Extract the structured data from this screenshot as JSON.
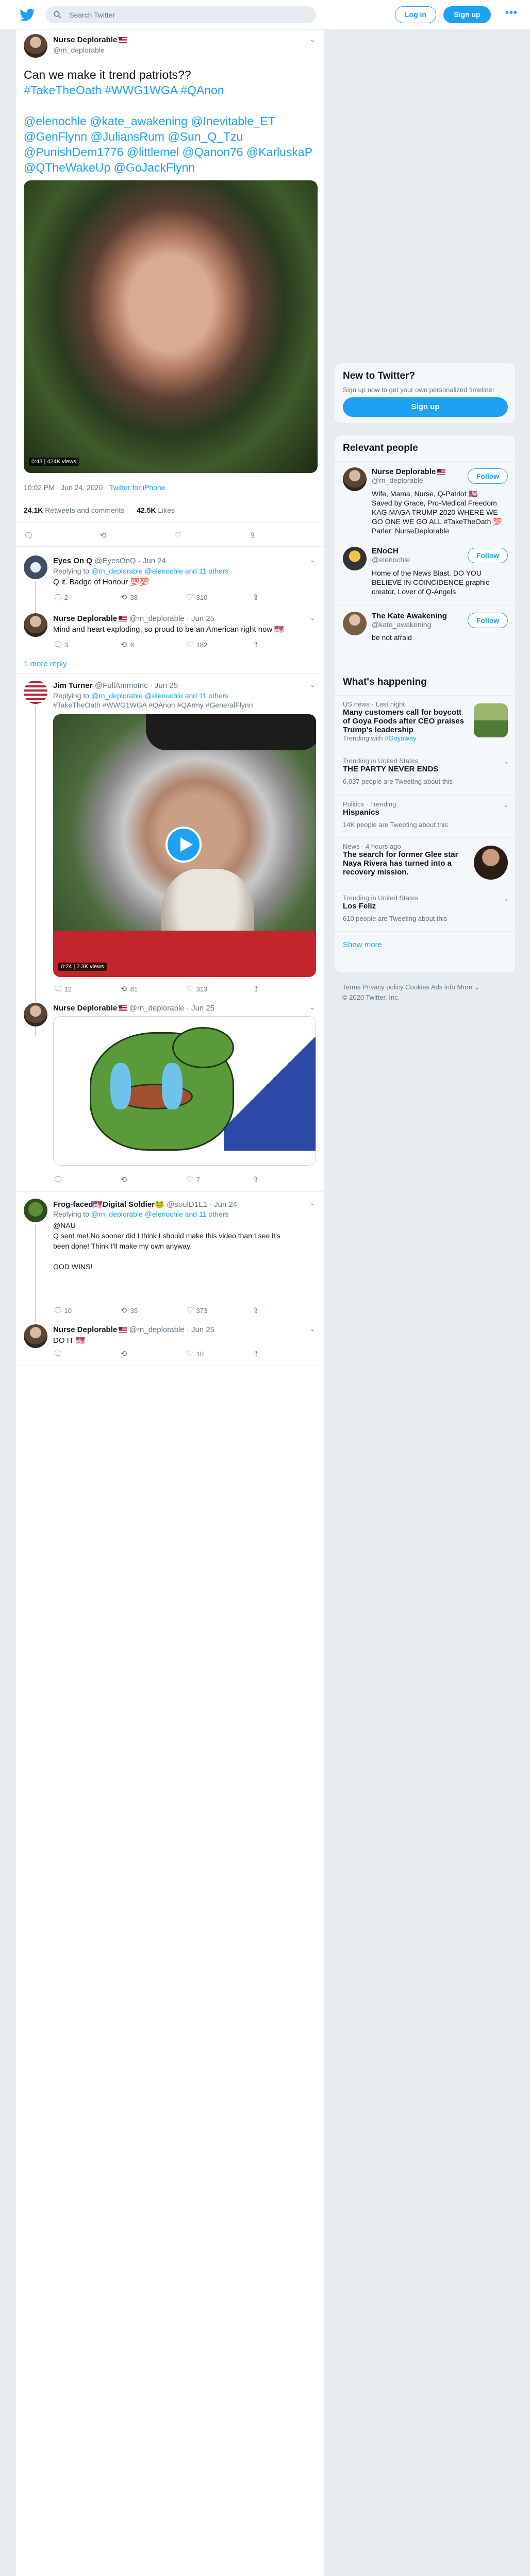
{
  "topbar": {
    "search_placeholder": "Search Twitter",
    "login_label": "Log in",
    "signup_label": "Sign up",
    "more_label": "•••"
  },
  "colors": {
    "accent": "#1da1f2",
    "text": "#14171a",
    "muted": "#657786",
    "background": "#e6ecf0"
  },
  "main_tweet": {
    "name": "Nurse Deplorable",
    "handle": "@rn_deplorable",
    "text_line1": "Can we make it trend patriots??",
    "hashtags_line": "#TakeTheOath #WWG1WGA #QAnon",
    "mentions_lines": [
      "@elenochle @kate_awakening @Inevitable_ET",
      "@GenFlynn @JuliansRum @Sun_Q_Tzu",
      "@PunishDem1776 @littlemel @Qanon76 @KarluskaP",
      "@QTheWakeUp @GoJackFlynn"
    ],
    "video_time": "0:43",
    "video_views": "424K views",
    "timestamp": "10:02 PM · Jun 24, 2020 ·",
    "source": "Twitter for iPhone",
    "retweets_count": "24.1K",
    "retweets_label": "Retweets and comments",
    "likes_count": "42.5K",
    "likes_label": "Likes"
  },
  "replies": [
    {
      "name": "Eyes On Q",
      "handle": "@EyesOnQ · Jun 24",
      "replying": "Replying to",
      "replying_to": "@rn_deplorable @elenochle and 11 others",
      "text": "Q it. Badge of Honour 💯💯",
      "reply_count": "2",
      "retweet_count": "38",
      "like_count": "310"
    },
    {
      "name": "Nurse Deplorable",
      "handle": "@rn_deplorable · Jun 25",
      "text": "Mind and heart exploding, so proud to be an American right now 🇺🇸",
      "reply_count": "3",
      "retweet_count": "6",
      "like_count": "182",
      "show_more": "1 more reply"
    },
    {
      "name": "Jim Turner",
      "handle": "@FullAmmoInc · Jun 25",
      "replying": "Replying to",
      "replying_to": "@rn_deplorable @elenochle and 11 others",
      "hashtags": "#TakeTheOath #WWG1WGA #QAnon #QArmy #GeneralFlynn",
      "video_time": "0:24",
      "video_views": "2.3K views",
      "reply_count": "12",
      "retweet_count": "81",
      "like_count": "313"
    },
    {
      "name": "Nurse Deplorable",
      "handle": "@rn_deplorable · Jun 25",
      "reply_count": "",
      "retweet_count": "",
      "like_count": "7"
    },
    {
      "name": "Frog-faced🇺🇸Digital Soldier🐸",
      "handle": "@soulD1L1 · Jun 24",
      "replying": "Replying to",
      "replying_to": "@rn_deplorable @elenochle and 11 others",
      "text_lines": [
        "@NAU",
        "Q sent me! No sooner did I think I should make this video than I see it's",
        "been done! Think I'll make my own anyway.",
        "",
        "GOD WINS!"
      ],
      "reply_count": "10",
      "retweet_count": "35",
      "like_count": "373"
    },
    {
      "name": "Nurse Deplorable",
      "handle": "@rn_deplorable · Jun 25",
      "text": "DO IT 🇺🇸",
      "reply_count": "",
      "retweet_count": "",
      "like_count": "10"
    }
  ],
  "sidebar": {
    "new_title": "New to Twitter?",
    "new_subtitle": "Sign up now to get your own personalized timeline!",
    "new_signup": "Sign up",
    "relevant_title": "Relevant people",
    "follow_label": "Follow",
    "people": [
      {
        "name": "Nurse Deplorable",
        "handle": "@rn_deplorable",
        "bio_lines": [
          "Wife, Mama, Nurse, Q-Patriot 🇺🇸",
          "Saved by Grace, Pro-Medical Freedom",
          "KAG MAGA TRUMP 2020 WHERE WE",
          "GO ONE WE GO ALL #TakeTheOath 💯",
          "Parler: NurseDeplorable"
        ]
      },
      {
        "name": "ENoCH",
        "handle": "@elenochle",
        "bio_lines": [
          "Home of the News Blast. DO YOU",
          "BELIEVE IN COINCIDENCE graphic",
          "creator, Lover of Q-Angels"
        ]
      },
      {
        "name": "The Kate Awakening",
        "handle": "@kate_awakening",
        "bio_lines": [
          "be not afraid"
        ]
      }
    ],
    "happening_title": "What's happening",
    "trends": [
      {
        "meta": "US news · Last night",
        "title_lines": [
          "Many customers call for boycott",
          "of Goya Foods after CEO praises",
          "Trump's leadership"
        ],
        "extra_prefix": "Trending with",
        "extra_link": "#Goyaway"
      },
      {
        "meta": "Trending in United States",
        "title_lines": [
          "THE PARTY NEVER ENDS"
        ],
        "count": "6,037 people are Tweeting about this"
      },
      {
        "meta": "Politics · Trending",
        "title_lines": [
          "Hispanics"
        ],
        "count": "14K people are Tweeting about this"
      },
      {
        "meta": "News · 4 hours ago",
        "title_lines": [
          "The search for former Glee star",
          "Naya Rivera has turned into a",
          "recovery mission."
        ]
      },
      {
        "meta": "Trending in United States",
        "title_lines": [
          "Los Feliz"
        ],
        "count": "610 people are Tweeting about this"
      }
    ],
    "show_more": "Show more",
    "footer_line1": "Terms    Privacy policy    Cookies    Ads info    More ⌄",
    "footer_line2": "© 2020 Twitter, Inc."
  }
}
